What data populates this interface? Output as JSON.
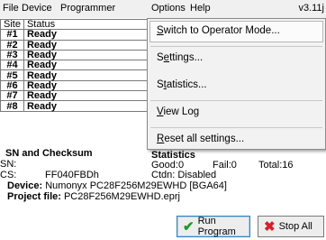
{
  "menubar": {
    "items": [
      "File",
      "Device",
      "Programmer",
      "Options",
      "Help"
    ],
    "version": "v3.11j"
  },
  "table": {
    "headers": [
      "Site",
      "Status"
    ],
    "rows": [
      {
        "site": "#1",
        "status": "Ready"
      },
      {
        "site": "#2",
        "status": "Ready"
      },
      {
        "site": "#3",
        "status": "Ready"
      },
      {
        "site": "#4",
        "status": "Ready"
      },
      {
        "site": "#5",
        "status": "Ready"
      },
      {
        "site": "#6",
        "status": "Ready"
      },
      {
        "site": "#7",
        "status": "Ready"
      },
      {
        "site": "#8",
        "status": "Ready"
      }
    ]
  },
  "sn_section": {
    "title": "SN and Checksum",
    "sn_label": "SN:",
    "cs_label": "CS:",
    "cs_value": "FF040FBDh"
  },
  "statistics": {
    "title": "Statistics",
    "good": "Good:0",
    "fail": "Fail:0",
    "total": "Total:16",
    "ctdn": "Ctdn: Disabled"
  },
  "device": {
    "label": "Device:",
    "value": "Numonyx PC28F256M29EWHD [BGA64]"
  },
  "project": {
    "label": "Project file:",
    "value": "PC28F256M29EWHD.eprj"
  },
  "buttons": {
    "run": "Run Program",
    "stop": "Stop All"
  },
  "options_menu": {
    "items": [
      {
        "accel": "S",
        "rest": "witch to Operator Mode..."
      },
      {
        "pre": "S",
        "accel": "e",
        "rest": "ttings..."
      },
      {
        "pre": "S",
        "accel": "t",
        "rest": "atistics..."
      },
      {
        "accel": "V",
        "rest": "iew Log"
      },
      {
        "accel": "R",
        "rest": "eset all settings..."
      }
    ]
  },
  "icons": {
    "run": "checkmark-icon",
    "stop": "x-icon"
  },
  "colors": {
    "run_icon": "#1e9a28",
    "stop_icon": "#d4222a",
    "menu_background": "#f2f2f2"
  }
}
